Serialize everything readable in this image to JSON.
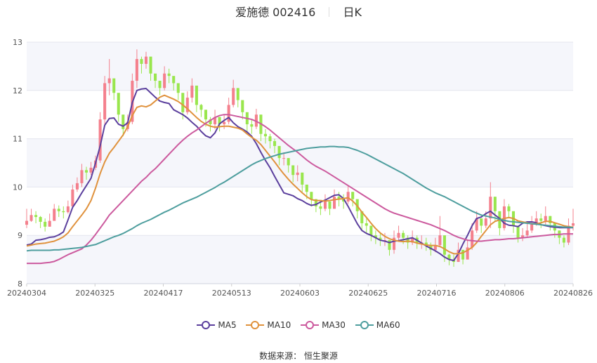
{
  "title": {
    "name": "爱施德",
    "code": "002416",
    "period": "日K"
  },
  "source": {
    "label": "数据来源：",
    "provider": "恒生聚源"
  },
  "chart_data": {
    "type": "candlestick",
    "ylim": [
      8,
      13
    ],
    "y_ticks": [
      8,
      9,
      10,
      11,
      12,
      13
    ],
    "x_tick_labels": [
      "20240304",
      "20240325",
      "20240417",
      "20240513",
      "20240603",
      "20240625",
      "20240716",
      "20240806",
      "20240826"
    ],
    "candles": {
      "count": 120,
      "up_color": "#f4808d",
      "down_color": "#99e64d",
      "closes": [
        9.3,
        9.42,
        9.38,
        9.28,
        9.18,
        9.3,
        9.55,
        9.5,
        9.48,
        9.6,
        9.95,
        10.08,
        10.35,
        10.3,
        10.4,
        10.55,
        11.4,
        12.15,
        12.25,
        11.95,
        11.5,
        11.2,
        11.35,
        12.2,
        12.65,
        12.55,
        12.7,
        12.35,
        12.2,
        12.05,
        12.35,
        12.3,
        12.15,
        11.95,
        11.55,
        11.85,
        12.1,
        11.7,
        11.6,
        11.4,
        11.3,
        11.45,
        11.3,
        11.35,
        11.7,
        12.05,
        11.8,
        11.55,
        11.3,
        11.25,
        11.5,
        11.1,
        11.05,
        10.95,
        10.85,
        10.6,
        10.6,
        10.45,
        10.25,
        10.3,
        10.05,
        9.9,
        9.75,
        9.6,
        9.55,
        9.7,
        9.55,
        9.8,
        9.75,
        9.7,
        9.9,
        9.75,
        9.5,
        9.25,
        9.2,
        9.0,
        8.95,
        8.9,
        8.9,
        8.7,
        8.95,
        9.05,
        8.95,
        8.85,
        8.95,
        8.85,
        8.85,
        8.8,
        8.7,
        8.8,
        9.0,
        8.6,
        8.5,
        8.45,
        8.7,
        8.5,
        8.75,
        9.1,
        9.35,
        9.2,
        9.35,
        9.8,
        9.5,
        9.15,
        9.6,
        9.5,
        9.2,
        8.95,
        9.0,
        9.1,
        9.25,
        9.35,
        9.3,
        9.4,
        9.25,
        9.1,
        8.95,
        8.85,
        9.2,
        9.25
      ],
      "highs": [
        9.55,
        9.55,
        9.5,
        9.4,
        9.35,
        9.45,
        9.65,
        9.62,
        9.6,
        9.72,
        10.05,
        10.2,
        10.48,
        10.42,
        10.52,
        10.65,
        11.55,
        12.3,
        12.65,
        12.1,
        11.62,
        11.35,
        11.5,
        12.35,
        12.85,
        12.7,
        12.8,
        12.5,
        12.32,
        12.2,
        12.5,
        12.45,
        12.28,
        12.1,
        11.7,
        11.98,
        12.25,
        11.85,
        11.72,
        11.55,
        11.45,
        11.6,
        11.45,
        11.5,
        11.85,
        12.22,
        11.95,
        11.7,
        11.45,
        11.4,
        11.62,
        11.25,
        11.2,
        11.1,
        11.0,
        10.75,
        10.72,
        10.6,
        10.4,
        10.45,
        10.2,
        10.05,
        9.9,
        9.75,
        9.7,
        9.85,
        9.7,
        9.95,
        9.9,
        9.85,
        10.02,
        9.9,
        9.65,
        9.4,
        9.35,
        9.15,
        9.1,
        9.05,
        9.05,
        8.85,
        9.1,
        9.2,
        9.1,
        9.0,
        9.1,
        9.0,
        9.0,
        8.95,
        8.85,
        8.95,
        9.4,
        8.75,
        8.62,
        8.6,
        8.85,
        8.65,
        8.9,
        9.25,
        9.5,
        9.35,
        9.5,
        10.1,
        9.7,
        9.35,
        9.75,
        9.65,
        9.35,
        9.1,
        9.15,
        9.25,
        9.4,
        9.5,
        9.45,
        9.6,
        9.4,
        9.25,
        9.1,
        9.0,
        9.35,
        9.55
      ],
      "lows": [
        9.15,
        9.28,
        9.25,
        9.15,
        9.08,
        9.18,
        9.4,
        9.38,
        9.35,
        9.45,
        9.6,
        9.9,
        10.0,
        10.15,
        10.25,
        10.35,
        10.5,
        11.3,
        11.9,
        11.8,
        11.35,
        11.05,
        11.15,
        11.3,
        12.05,
        12.35,
        12.45,
        12.2,
        12.05,
        11.9,
        12.0,
        12.15,
        12.0,
        11.8,
        11.4,
        11.5,
        11.75,
        11.55,
        11.45,
        11.25,
        11.15,
        11.2,
        11.15,
        11.2,
        11.3,
        11.65,
        11.65,
        11.4,
        11.15,
        11.1,
        11.2,
        10.95,
        10.9,
        10.8,
        10.7,
        10.45,
        10.45,
        10.3,
        10.1,
        10.12,
        9.9,
        9.75,
        9.6,
        9.48,
        9.42,
        9.5,
        9.42,
        9.55,
        9.6,
        9.55,
        9.65,
        9.6,
        9.35,
        9.1,
        9.05,
        8.88,
        8.82,
        8.78,
        8.78,
        8.58,
        8.62,
        8.9,
        8.82,
        8.72,
        8.8,
        8.72,
        8.72,
        8.68,
        8.58,
        8.65,
        8.75,
        8.45,
        8.38,
        8.35,
        8.45,
        8.4,
        8.5,
        8.7,
        9.05,
        9.05,
        9.15,
        9.15,
        9.3,
        9.0,
        9.1,
        9.35,
        9.05,
        8.85,
        8.88,
        8.95,
        9.05,
        9.2,
        9.15,
        9.22,
        9.1,
        8.95,
        8.82,
        8.75,
        8.8,
        9.1
      ]
    },
    "series": [
      {
        "name": "MA5",
        "color": "#5b3f9d",
        "values": [
          8.8,
          8.82,
          8.9,
          8.91,
          8.93,
          8.96,
          8.97,
          9.01,
          9.07,
          9.32,
          9.58,
          9.72,
          9.88,
          10.03,
          10.18,
          10.5,
          10.85,
          11.28,
          11.42,
          11.43,
          11.3,
          11.26,
          11.33,
          11.75,
          12.0,
          12.03,
          12.04,
          11.95,
          11.86,
          11.78,
          11.75,
          11.73,
          11.6,
          11.55,
          11.5,
          11.43,
          11.34,
          11.26,
          11.15,
          11.06,
          11.02,
          11.12,
          11.31,
          11.38,
          11.44,
          11.33,
          11.25,
          11.2,
          11.14,
          11.05,
          10.9,
          10.72,
          10.55,
          10.4,
          10.22,
          10.05,
          9.88,
          9.85,
          9.82,
          9.76,
          9.72,
          9.66,
          9.62,
          9.64,
          9.69,
          9.73,
          9.78,
          9.83,
          9.84,
          9.76,
          9.6,
          9.42,
          9.24,
          9.1,
          9.04,
          9.0,
          8.95,
          8.9,
          8.88,
          8.85,
          8.88,
          8.89,
          8.91,
          8.93,
          8.95,
          8.9,
          8.84,
          8.78,
          8.73,
          8.68,
          8.62,
          8.55,
          8.5,
          8.48,
          8.62,
          8.82,
          9.0,
          9.2,
          9.35,
          9.38,
          9.45,
          9.5,
          9.42,
          9.35,
          9.25,
          9.21,
          9.2,
          9.18,
          9.25,
          9.28,
          9.28,
          9.26,
          9.22,
          9.2,
          9.18,
          9.17,
          9.16,
          9.16,
          9.16,
          9.16
        ]
      },
      {
        "name": "MA10",
        "color": "#e0923d",
        "values": [
          8.78,
          8.8,
          8.82,
          8.83,
          8.84,
          8.86,
          8.88,
          8.92,
          8.97,
          9.05,
          9.18,
          9.3,
          9.42,
          9.55,
          9.72,
          9.98,
          10.28,
          10.52,
          10.7,
          10.82,
          10.95,
          11.08,
          11.25,
          11.48,
          11.65,
          11.68,
          11.66,
          11.7,
          11.78,
          11.86,
          11.9,
          11.86,
          11.82,
          11.77,
          11.7,
          11.62,
          11.53,
          11.44,
          11.36,
          11.3,
          11.26,
          11.24,
          11.25,
          11.26,
          11.26,
          11.24,
          11.22,
          11.18,
          11.1,
          11.03,
          10.97,
          10.88,
          10.76,
          10.64,
          10.52,
          10.39,
          10.27,
          10.16,
          10.06,
          9.97,
          9.88,
          9.8,
          9.74,
          9.72,
          9.72,
          9.71,
          9.72,
          9.74,
          9.75,
          9.76,
          9.78,
          9.71,
          9.61,
          9.48,
          9.37,
          9.25,
          9.14,
          9.05,
          8.98,
          8.93,
          8.9,
          8.88,
          8.87,
          8.88,
          8.87,
          8.84,
          8.82,
          8.8,
          8.79,
          8.79,
          8.77,
          8.72,
          8.66,
          8.62,
          8.62,
          8.64,
          8.69,
          8.75,
          8.85,
          8.98,
          9.1,
          9.22,
          9.29,
          9.32,
          9.35,
          9.37,
          9.35,
          9.3,
          9.28,
          9.26,
          9.24,
          9.24,
          9.26,
          9.29,
          9.29,
          9.26,
          9.23,
          9.2,
          9.18,
          9.17
        ]
      },
      {
        "name": "MA30",
        "color": "#cc5a9e",
        "values": [
          8.42,
          8.42,
          8.42,
          8.42,
          8.43,
          8.44,
          8.46,
          8.5,
          8.55,
          8.6,
          8.64,
          8.68,
          8.72,
          8.8,
          8.9,
          9.02,
          9.15,
          9.28,
          9.42,
          9.52,
          9.62,
          9.72,
          9.82,
          9.92,
          10.02,
          10.12,
          10.2,
          10.3,
          10.38,
          10.48,
          10.58,
          10.68,
          10.78,
          10.88,
          10.97,
          11.05,
          11.12,
          11.18,
          11.25,
          11.32,
          11.38,
          11.44,
          11.48,
          11.5,
          11.5,
          11.48,
          11.46,
          11.44,
          11.42,
          11.4,
          11.36,
          11.31,
          11.25,
          11.18,
          11.1,
          11.02,
          10.94,
          10.86,
          10.79,
          10.72,
          10.64,
          10.56,
          10.49,
          10.43,
          10.38,
          10.33,
          10.27,
          10.21,
          10.15,
          10.09,
          10.03,
          9.97,
          9.91,
          9.85,
          9.79,
          9.73,
          9.67,
          9.61,
          9.55,
          9.5,
          9.46,
          9.43,
          9.4,
          9.37,
          9.34,
          9.31,
          9.28,
          9.25,
          9.22,
          9.18,
          9.14,
          9.1,
          9.05,
          9.0,
          8.96,
          8.93,
          8.9,
          8.89,
          8.88,
          8.88,
          8.89,
          8.9,
          8.91,
          8.91,
          8.92,
          8.93,
          8.93,
          8.94,
          8.95,
          8.96,
          8.97,
          8.98,
          8.99,
          9.0,
          9.01,
          9.02,
          9.02,
          9.03,
          9.03,
          9.03
        ]
      },
      {
        "name": "MA60",
        "color": "#4e9e9e",
        "values": [
          8.68,
          8.69,
          8.69,
          8.69,
          8.69,
          8.69,
          8.7,
          8.7,
          8.71,
          8.72,
          8.73,
          8.74,
          8.75,
          8.77,
          8.79,
          8.81,
          8.85,
          8.89,
          8.93,
          8.97,
          9.0,
          9.04,
          9.09,
          9.14,
          9.2,
          9.25,
          9.29,
          9.33,
          9.38,
          9.43,
          9.48,
          9.52,
          9.57,
          9.62,
          9.67,
          9.71,
          9.75,
          9.79,
          9.84,
          9.89,
          9.94,
          9.99,
          10.05,
          10.1,
          10.16,
          10.22,
          10.28,
          10.34,
          10.4,
          10.46,
          10.51,
          10.55,
          10.59,
          10.62,
          10.65,
          10.68,
          10.7,
          10.72,
          10.74,
          10.76,
          10.78,
          10.8,
          10.81,
          10.82,
          10.83,
          10.83,
          10.84,
          10.84,
          10.83,
          10.83,
          10.82,
          10.79,
          10.76,
          10.72,
          10.68,
          10.63,
          10.58,
          10.53,
          10.48,
          10.43,
          10.38,
          10.33,
          10.28,
          10.22,
          10.16,
          10.1,
          10.04,
          9.98,
          9.93,
          9.88,
          9.84,
          9.8,
          9.75,
          9.7,
          9.65,
          9.6,
          9.55,
          9.5,
          9.46,
          9.42,
          9.4,
          9.38,
          9.36,
          9.33,
          9.31,
          9.29,
          9.28,
          9.27,
          9.26,
          9.25,
          9.24,
          9.23,
          9.22,
          9.21,
          9.2,
          9.19,
          9.18,
          9.17,
          9.17,
          9.16
        ]
      }
    ],
    "legend_position": "bottom-center",
    "grid": true
  }
}
